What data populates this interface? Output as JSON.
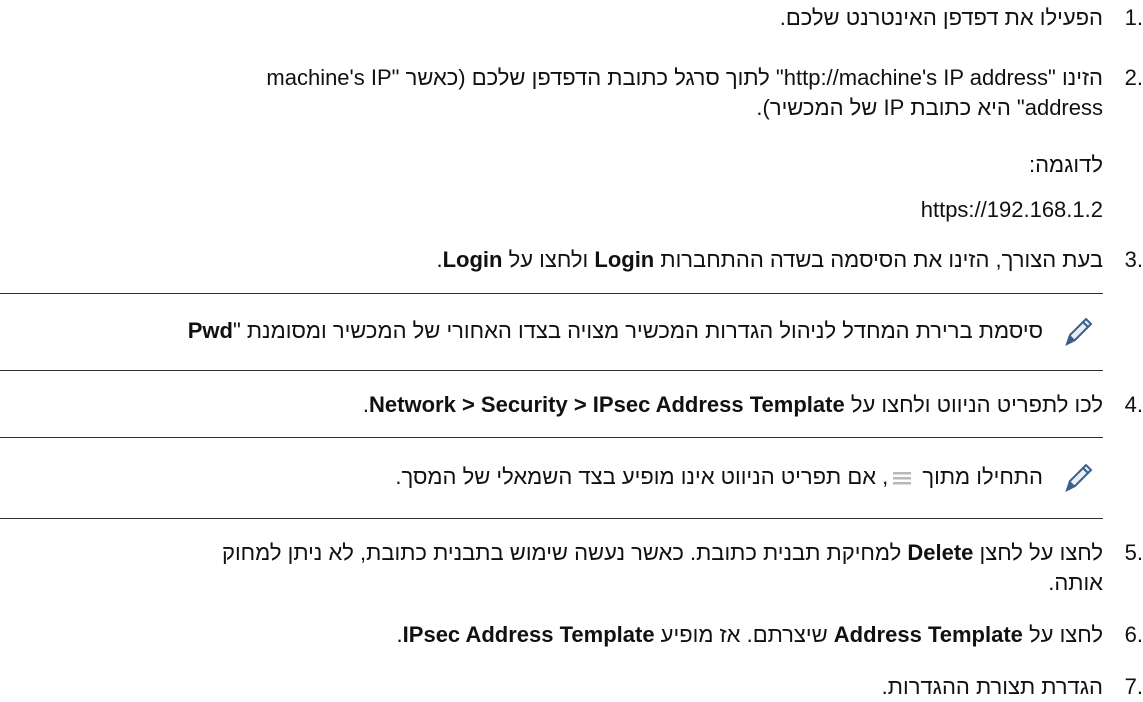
{
  "steps": [
    {
      "num": "1.",
      "text": "הפעילו את דפדפן האינטרנט שלכם."
    },
    {
      "num": "2.",
      "line1": "הזינו \"http://machine's IP address\" לתוך סרגל כתובת הדפדפן שלכם (כאשר \"machine's IP",
      "line2": "address\" היא כתובת IP של המכשיר)."
    },
    {
      "num": "3.",
      "pre": "בעת הצורך, הזינו את הסיסמה בשדה ההתחברות ",
      "b1": "Login",
      "mid": " ולחצו על ",
      "b2": "Login",
      "post": "."
    },
    {
      "num": "4.",
      "pre": "לכו לתפריט הניווט ולחצו על ",
      "b1": "Network > Security > IPsec Address Template",
      "post": "."
    },
    {
      "num": "5.",
      "pre": "לחצו על לחצן ",
      "b1": "Delete",
      "post": " למחיקת תבנית כתובת. כאשר נעשה שימוש בתבנית כתובת, לא ניתן למחוק",
      "line2": "אותה."
    },
    {
      "num": "6.",
      "pre": "לחצו על ",
      "b1": "Address Template",
      "mid": " שיצרתם. אז מופיע ",
      "b2": "IPsec Address Template",
      "post": "."
    },
    {
      "num": "7.",
      "text": "הגדרת תצורת ההגדרות."
    }
  ],
  "example_label": "לדוגמה:",
  "example_value": "https://192.168.1.2",
  "note1": {
    "pre": "סיסמת ברירת המחדל לניהול הגדרות המכשיר מצויה בצדו האחורי של המכשיר ומסומנת \"",
    "bold": "Pwd",
    "icon": "pencil-icon"
  },
  "note2": {
    "pre": "התחילו מתוך ",
    "post": ", אם תפריט הניווט אינו מופיע בצד השמאלי של המסך.",
    "icon": "pencil-icon",
    "menu_icon": "menu-icon"
  }
}
